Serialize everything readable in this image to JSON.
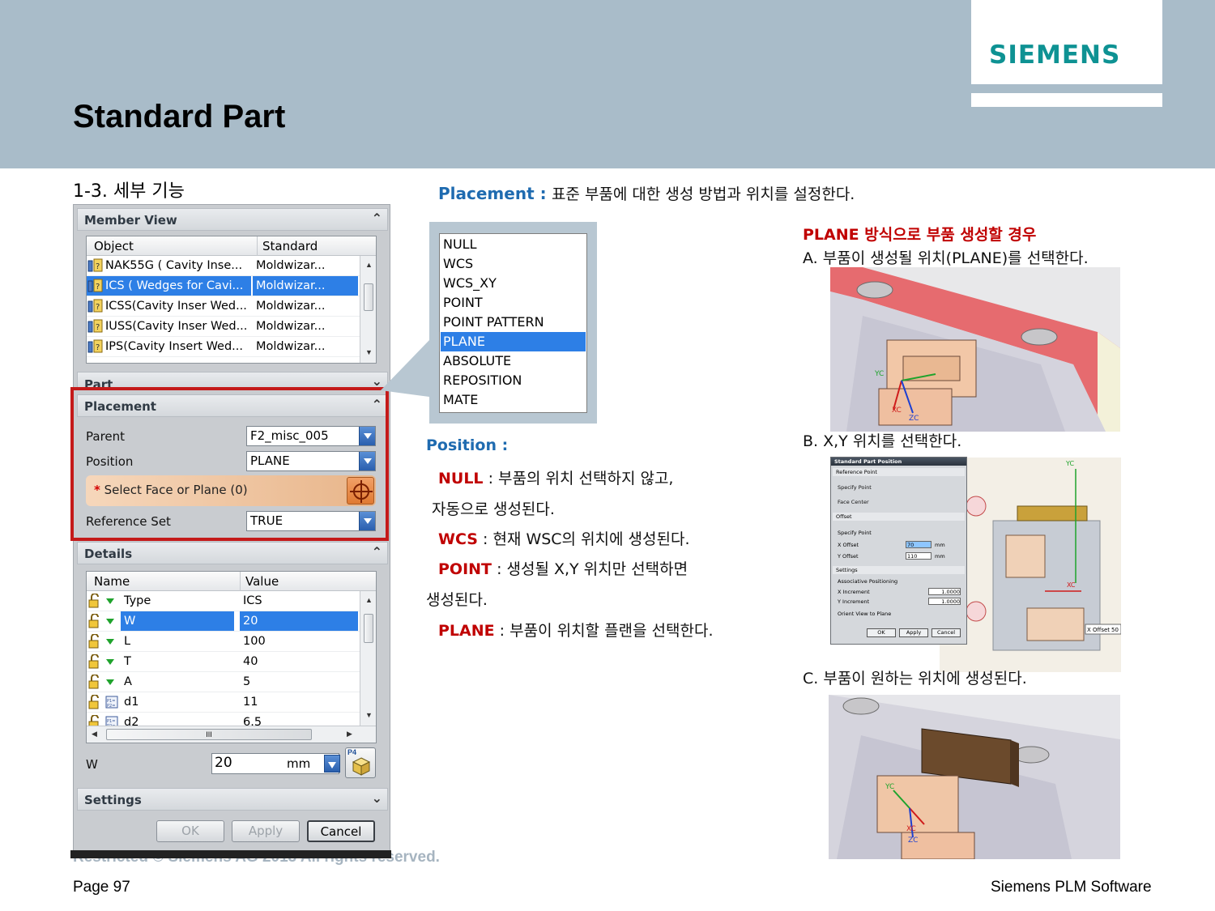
{
  "header": {
    "logo": "SIEMENS",
    "title": "Standard Part"
  },
  "section_title": "1-3. 세부 기능",
  "placement_desc": {
    "label": "Placement  :",
    "text": "표준 부품에 대한 생성 방법과 위치를 설정한다."
  },
  "dialog": {
    "member_view": {
      "title": "Member View",
      "columns": [
        "Object",
        "Standard"
      ],
      "rows": [
        {
          "object": "NAK55G ( Cavity Inse...",
          "standard": "Moldwizar..."
        },
        {
          "object": "ICS ( Wedges for Cavi...",
          "standard": "Moldwizar...",
          "selected": true
        },
        {
          "object": "ICSS(Cavity Inser Wed...",
          "standard": "Moldwizar..."
        },
        {
          "object": "IUSS(Cavity Inser Wed...",
          "standard": "Moldwizar..."
        },
        {
          "object": "IPS(Cavity Insert Wed...",
          "standard": "Moldwizar..."
        }
      ]
    },
    "part": {
      "title": "Part"
    },
    "placement": {
      "title": "Placement",
      "parent_label": "Parent",
      "parent_value": "F2_misc_005",
      "position_label": "Position",
      "position_value": "PLANE",
      "select_face": "Select Face or Plane (0)",
      "refset_label": "Reference Set",
      "refset_value": "TRUE"
    },
    "details": {
      "title": "Details",
      "columns": [
        "Name",
        "Value"
      ],
      "rows": [
        {
          "name": "Type",
          "value": "ICS"
        },
        {
          "name": "W",
          "value": "20",
          "selected": true
        },
        {
          "name": "L",
          "value": "100"
        },
        {
          "name": "T",
          "value": "40"
        },
        {
          "name": "A",
          "value": "5"
        },
        {
          "name": "d1",
          "value": "11"
        },
        {
          "name": "d2",
          "value": "6.5"
        }
      ],
      "scroll_label": "III"
    },
    "w_field": {
      "label": "W",
      "value": "20",
      "unit": "mm",
      "button_label": "P4"
    },
    "settings": {
      "title": "Settings"
    },
    "buttons": {
      "ok": "OK",
      "apply": "Apply",
      "cancel": "Cancel"
    }
  },
  "position_list": {
    "items": [
      "NULL",
      "WCS",
      "WCS_XY",
      "POINT",
      "POINT PATTERN",
      "PLANE",
      "ABSOLUTE",
      "REPOSITION",
      "MATE"
    ],
    "selected": "PLANE"
  },
  "position_desc": {
    "title": "Position :",
    "null_label": "NULL",
    "null_text": ": 부품의 위치 선택하지 않고,",
    "null_text2": "자동으로 생성된다.",
    "wcs_label": "WCS",
    "wcs_text": ": 현재 WSC의 위치에 생성된다.",
    "point_label": "POINT",
    "point_text": ": 생성될 X,Y 위치만 선택하면",
    "point_text2": "생성된다.",
    "plane_label": "PLANE",
    "plane_text": ": 부품이 위치할 플랜을 선택한다."
  },
  "plane_steps": {
    "title": "PLANE 방식으로 부품 생성할 경우",
    "step_a": "A.   부품이 생성될 위치(PLANE)를 선택한다.",
    "step_b": "B.   X,Y 위치를 선택한다.",
    "step_c": "C.   부품이 원하는 위치에 생성된다."
  },
  "mini_dialog": {
    "title": "Standard Part Position",
    "ref_point": "Reference Point",
    "specify_point": "Specify Point",
    "face_center": "Face Center",
    "offset": "Offset",
    "specify_point2": "Specify Point",
    "x_offset": "X Offset",
    "x_value": "70",
    "y_offset": "Y Offset",
    "y_value": "110",
    "unit": "mm",
    "settings": "Settings",
    "assoc": "Associative Positioning",
    "x_inc": "X Increment",
    "x_inc_val": "1.0000",
    "y_inc": "Y Increment",
    "y_inc_val": "1.0000",
    "orient": "Orient View to Plane",
    "ok": "OK",
    "apply": "Apply",
    "cancel": "Cancel"
  },
  "cad_labels": {
    "yc": "YC",
    "xc": "XC",
    "zc": "ZC",
    "xoffset_tag": "X Offset",
    "xoffset_val": "50"
  },
  "footer": {
    "copyright": "Restricted © Siemens AG 2013 All rights reserved.",
    "page": "Page 97",
    "company": "Siemens PLM Software"
  },
  "colors": {
    "header_bg": "#a9bcc9",
    "logo": "#0e9293",
    "accent_blue": "#1f6bb0",
    "accent_red": "#c00000",
    "selection": "#2d7fe6"
  }
}
